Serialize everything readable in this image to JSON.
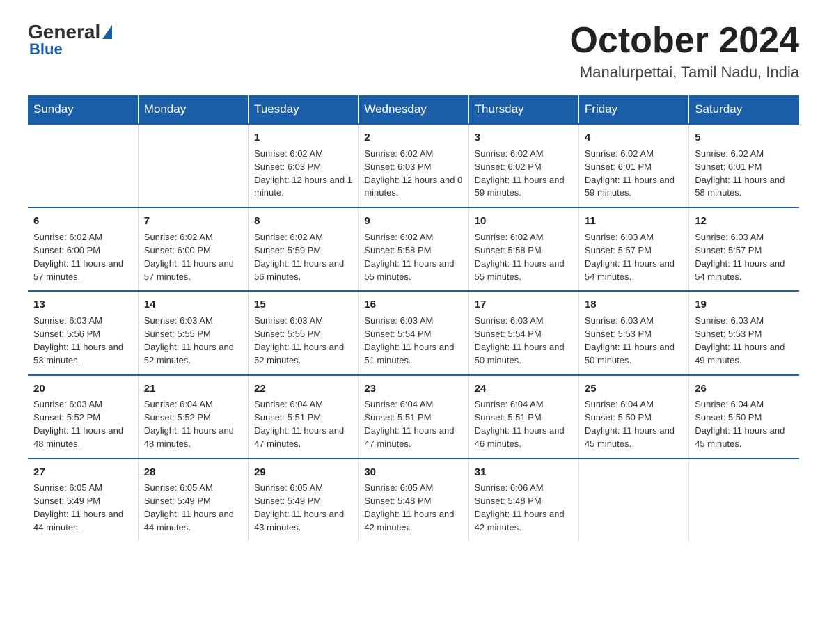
{
  "header": {
    "logo": {
      "general": "General",
      "blue": "Blue",
      "subtitle": "Blue"
    },
    "title": "October 2024",
    "location": "Manalurpettai, Tamil Nadu, India"
  },
  "calendar": {
    "days_of_week": [
      "Sunday",
      "Monday",
      "Tuesday",
      "Wednesday",
      "Thursday",
      "Friday",
      "Saturday"
    ],
    "weeks": [
      [
        {
          "day": "",
          "info": ""
        },
        {
          "day": "",
          "info": ""
        },
        {
          "day": "1",
          "info": "Sunrise: 6:02 AM\nSunset: 6:03 PM\nDaylight: 12 hours and 1 minute."
        },
        {
          "day": "2",
          "info": "Sunrise: 6:02 AM\nSunset: 6:03 PM\nDaylight: 12 hours and 0 minutes."
        },
        {
          "day": "3",
          "info": "Sunrise: 6:02 AM\nSunset: 6:02 PM\nDaylight: 11 hours and 59 minutes."
        },
        {
          "day": "4",
          "info": "Sunrise: 6:02 AM\nSunset: 6:01 PM\nDaylight: 11 hours and 59 minutes."
        },
        {
          "day": "5",
          "info": "Sunrise: 6:02 AM\nSunset: 6:01 PM\nDaylight: 11 hours and 58 minutes."
        }
      ],
      [
        {
          "day": "6",
          "info": "Sunrise: 6:02 AM\nSunset: 6:00 PM\nDaylight: 11 hours and 57 minutes."
        },
        {
          "day": "7",
          "info": "Sunrise: 6:02 AM\nSunset: 6:00 PM\nDaylight: 11 hours and 57 minutes."
        },
        {
          "day": "8",
          "info": "Sunrise: 6:02 AM\nSunset: 5:59 PM\nDaylight: 11 hours and 56 minutes."
        },
        {
          "day": "9",
          "info": "Sunrise: 6:02 AM\nSunset: 5:58 PM\nDaylight: 11 hours and 55 minutes."
        },
        {
          "day": "10",
          "info": "Sunrise: 6:02 AM\nSunset: 5:58 PM\nDaylight: 11 hours and 55 minutes."
        },
        {
          "day": "11",
          "info": "Sunrise: 6:03 AM\nSunset: 5:57 PM\nDaylight: 11 hours and 54 minutes."
        },
        {
          "day": "12",
          "info": "Sunrise: 6:03 AM\nSunset: 5:57 PM\nDaylight: 11 hours and 54 minutes."
        }
      ],
      [
        {
          "day": "13",
          "info": "Sunrise: 6:03 AM\nSunset: 5:56 PM\nDaylight: 11 hours and 53 minutes."
        },
        {
          "day": "14",
          "info": "Sunrise: 6:03 AM\nSunset: 5:55 PM\nDaylight: 11 hours and 52 minutes."
        },
        {
          "day": "15",
          "info": "Sunrise: 6:03 AM\nSunset: 5:55 PM\nDaylight: 11 hours and 52 minutes."
        },
        {
          "day": "16",
          "info": "Sunrise: 6:03 AM\nSunset: 5:54 PM\nDaylight: 11 hours and 51 minutes."
        },
        {
          "day": "17",
          "info": "Sunrise: 6:03 AM\nSunset: 5:54 PM\nDaylight: 11 hours and 50 minutes."
        },
        {
          "day": "18",
          "info": "Sunrise: 6:03 AM\nSunset: 5:53 PM\nDaylight: 11 hours and 50 minutes."
        },
        {
          "day": "19",
          "info": "Sunrise: 6:03 AM\nSunset: 5:53 PM\nDaylight: 11 hours and 49 minutes."
        }
      ],
      [
        {
          "day": "20",
          "info": "Sunrise: 6:03 AM\nSunset: 5:52 PM\nDaylight: 11 hours and 48 minutes."
        },
        {
          "day": "21",
          "info": "Sunrise: 6:04 AM\nSunset: 5:52 PM\nDaylight: 11 hours and 48 minutes."
        },
        {
          "day": "22",
          "info": "Sunrise: 6:04 AM\nSunset: 5:51 PM\nDaylight: 11 hours and 47 minutes."
        },
        {
          "day": "23",
          "info": "Sunrise: 6:04 AM\nSunset: 5:51 PM\nDaylight: 11 hours and 47 minutes."
        },
        {
          "day": "24",
          "info": "Sunrise: 6:04 AM\nSunset: 5:51 PM\nDaylight: 11 hours and 46 minutes."
        },
        {
          "day": "25",
          "info": "Sunrise: 6:04 AM\nSunset: 5:50 PM\nDaylight: 11 hours and 45 minutes."
        },
        {
          "day": "26",
          "info": "Sunrise: 6:04 AM\nSunset: 5:50 PM\nDaylight: 11 hours and 45 minutes."
        }
      ],
      [
        {
          "day": "27",
          "info": "Sunrise: 6:05 AM\nSunset: 5:49 PM\nDaylight: 11 hours and 44 minutes."
        },
        {
          "day": "28",
          "info": "Sunrise: 6:05 AM\nSunset: 5:49 PM\nDaylight: 11 hours and 44 minutes."
        },
        {
          "day": "29",
          "info": "Sunrise: 6:05 AM\nSunset: 5:49 PM\nDaylight: 11 hours and 43 minutes."
        },
        {
          "day": "30",
          "info": "Sunrise: 6:05 AM\nSunset: 5:48 PM\nDaylight: 11 hours and 42 minutes."
        },
        {
          "day": "31",
          "info": "Sunrise: 6:06 AM\nSunset: 5:48 PM\nDaylight: 11 hours and 42 minutes."
        },
        {
          "day": "",
          "info": ""
        },
        {
          "day": "",
          "info": ""
        }
      ]
    ]
  }
}
